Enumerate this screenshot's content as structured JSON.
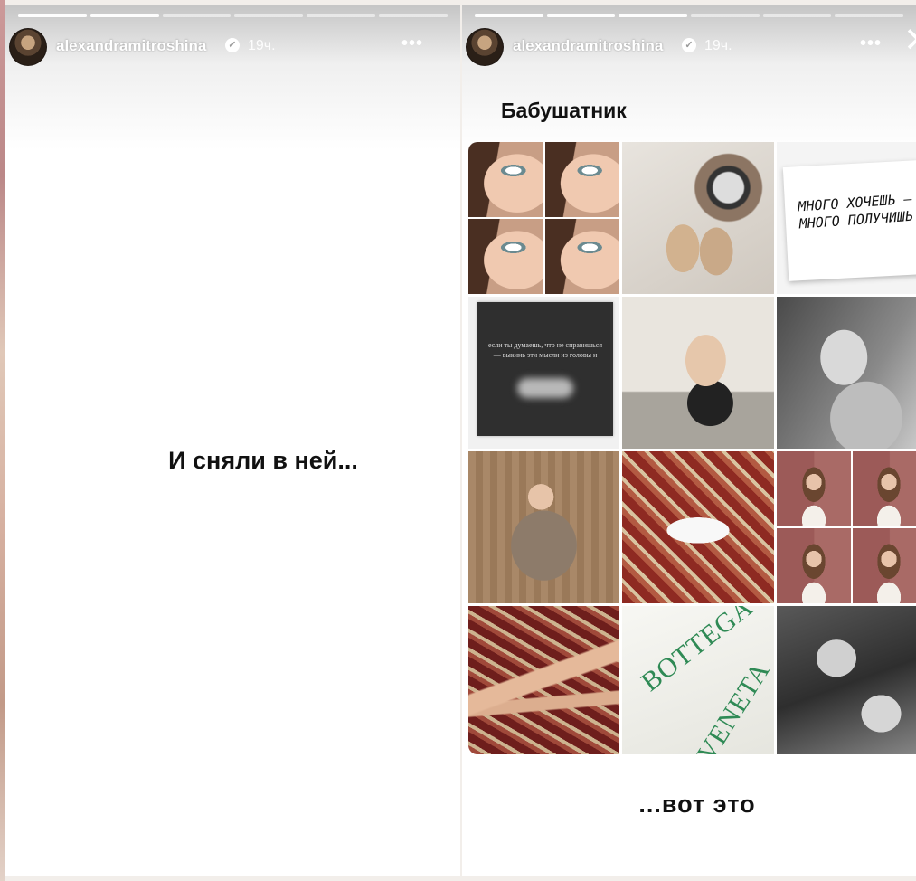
{
  "left_story": {
    "username": "alexandramitroshina",
    "time": "19ч.",
    "more": "•••",
    "close": "✕",
    "caption": "И сняли в ней..."
  },
  "right_story": {
    "username": "alexandramitroshina",
    "time": "19ч.",
    "more": "•••",
    "close": "✕",
    "board_title": "Бабушатник",
    "note_text": "МНОГО ХОЧЕШЬ — МНОГО ПОЛУЧИШЬ",
    "quote_text": "если ты думаешь, что не справишься — выкинь эти мысли из головы и",
    "bag_text_1": "BOTTEGA",
    "bag_text_2": "VENETA",
    "caption": "...вот это"
  },
  "colors": {
    "text": "#111111",
    "header_text": "#ffffff",
    "bag_print": "#2f8a55"
  }
}
